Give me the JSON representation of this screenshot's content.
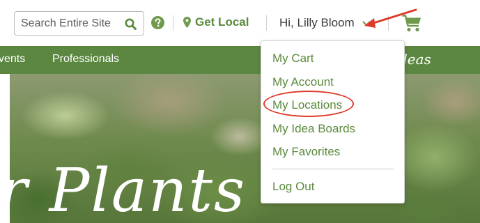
{
  "header": {
    "search": {
      "placeholder": "Search Entire Site"
    },
    "get_local_label": "Get Local",
    "user_greeting": "Hi, Lilly Bloom"
  },
  "nav": {
    "items": [
      {
        "label": "vents"
      },
      {
        "label": "Professionals"
      }
    ],
    "ideas_label": "deas"
  },
  "hero": {
    "headline": "r Plants"
  },
  "account_menu": {
    "items": [
      {
        "label": "My Cart"
      },
      {
        "label": "My Account"
      },
      {
        "label": "My Locations"
      },
      {
        "label": "My Idea Boards"
      },
      {
        "label": "My Favorites"
      },
      {
        "label": "Log Out"
      }
    ],
    "highlighted_item": "My Locations"
  },
  "colors": {
    "brand_green": "#5b8741",
    "link_green": "#5a8a3c",
    "annotation_red": "#e03a2a"
  },
  "icons": [
    "search-icon",
    "help-icon",
    "map-pin-icon",
    "chevron-down-icon",
    "shopping-cart-icon"
  ]
}
